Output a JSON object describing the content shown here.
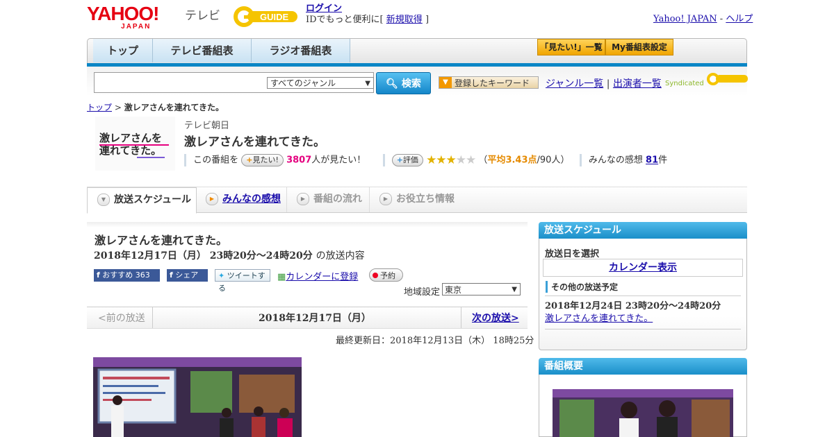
{
  "header": {
    "yahoo_logo": "YAHOO!",
    "yahoo_logo_sub": "JAPAN",
    "tv_label": "テレビ",
    "gguide_logo": "GUIDE",
    "login_label": "ログイン",
    "id_prompt_prefix": "IDでもっと便利に[",
    "signup_label": "新規取得",
    "id_prompt_suffix": "]",
    "yahoo_japan_link": "Yahoo! JAPAN",
    "separator": "-",
    "help_link": "ヘルプ"
  },
  "nav": {
    "tabs": [
      {
        "label": "トップ"
      },
      {
        "label": "テレビ番組表"
      },
      {
        "label": "ラジオ番組表"
      }
    ],
    "watchlist_button": "「見たい!」一覧",
    "my_schedule_button": "My番組表設定"
  },
  "search": {
    "placeholder": "",
    "genre_selected": "すべてのジャンル",
    "search_button": "検索",
    "keyword_button": "登録したキーワード",
    "genre_list_link": "ジャンル一覧",
    "link_sep": "|",
    "performer_list_link": "出演者一覧",
    "syndicated_label": "Syndicated"
  },
  "breadcrumb": {
    "top": "トップ",
    "sep": ">",
    "current": "激レアさんを連れてきた。"
  },
  "program": {
    "thumb_text": "激レアさんを連れてきた。",
    "station": "テレビ朝日",
    "title": "激レアさんを連れてきた。",
    "want_prefix": "この番組を",
    "want_button": "見たい!",
    "want_count": "3807",
    "want_suffix": "人が見たい！",
    "rate_button": "評価",
    "stars_on": "★★★",
    "stars_off": "★★",
    "rating_open": "（",
    "rating_avg": "平均3.43点",
    "rating_count": "/90人）",
    "review_prefix": "みんなの感想",
    "review_count": "81",
    "review_suffix": "件",
    "rating_value": 3.43
  },
  "subtabs": [
    {
      "label": "放送スケジュール"
    },
    {
      "label": "みんなの感想"
    },
    {
      "label": "番組の流れ"
    },
    {
      "label": "お役立ち情報"
    }
  ],
  "broadcast": {
    "title": "激レアさんを連れてきた。",
    "date_time": "2018年12月17日（月） 23時20分～24時20分",
    "date_suffix": "の放送内容",
    "fb_recommend": "おすすめ",
    "fb_recommend_count": "363",
    "fb_share": "シェア",
    "tweet": "ツイートする",
    "calendar_register": "カレンダーに登録",
    "reserve": "予約",
    "region_label": "地域設定",
    "region_value": "東京",
    "prev_label": "<前の放送",
    "current_date": "2018年12月17日（月）",
    "next_label": "次の放送>",
    "updated": "最終更新日：2018年12月13日（木） 18時25分"
  },
  "sidebar": {
    "schedule_heading": "放送スケジュール",
    "select_date_label": "放送日を選択",
    "calendar_link": "カレンダー表示",
    "other_label": "その他の放送予定",
    "other_date": "2018年12月24日 23時20分～24時20分",
    "other_title": "激レアさんを連れてきた。",
    "summary_heading": "番組概要"
  },
  "colors": {
    "accent_blue": "#1a8fc9",
    "yahoo_red": "#e60012",
    "gguide_yellow": "#f5c400",
    "want_pink": "#e4007f",
    "star_gold": "#e2b200"
  }
}
